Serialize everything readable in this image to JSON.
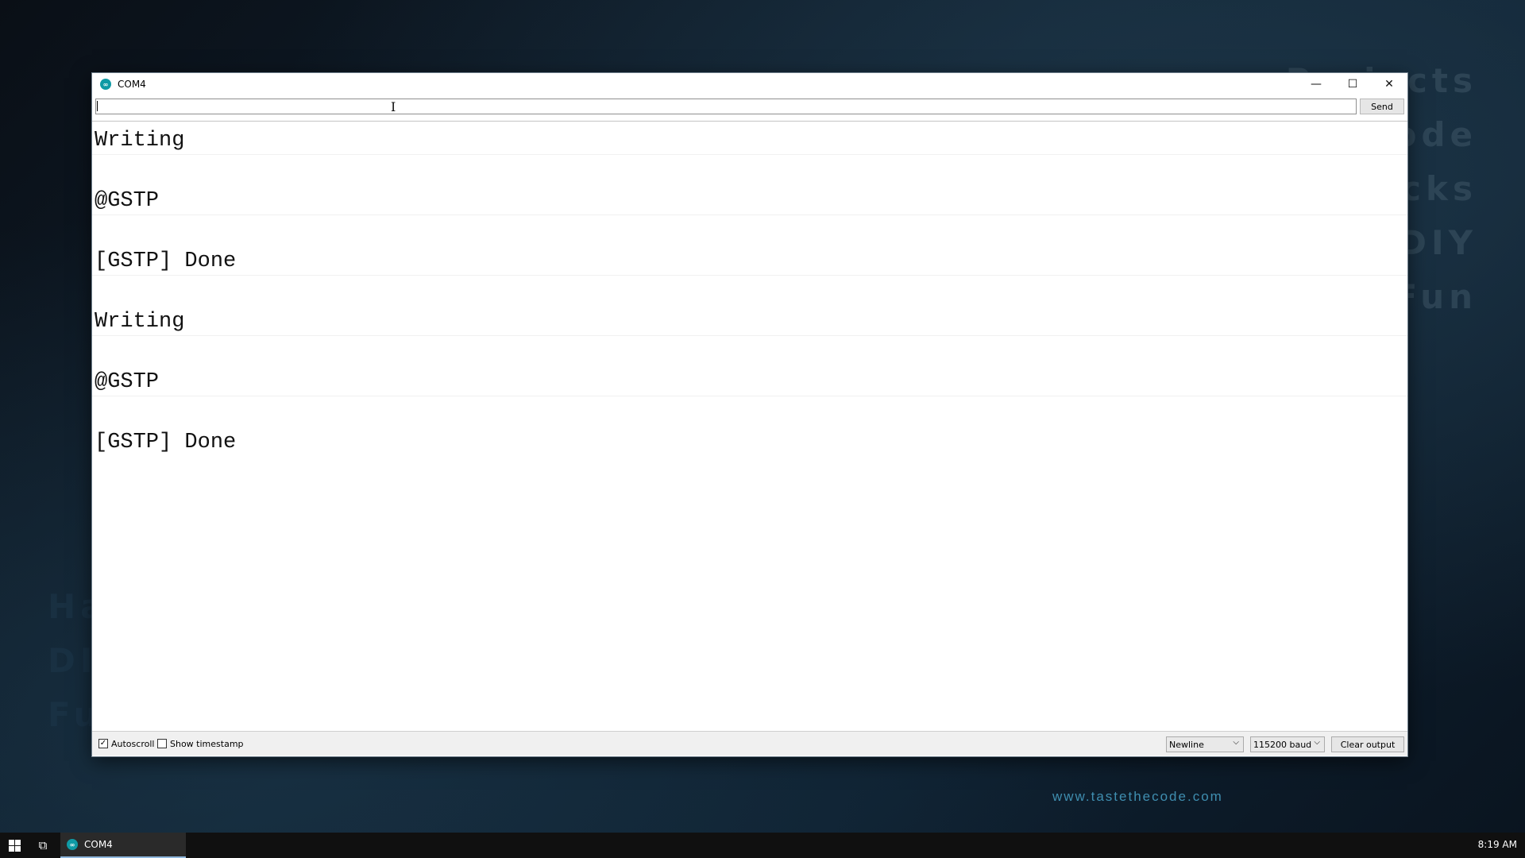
{
  "window": {
    "title": "COM4",
    "minimize_glyph": "—",
    "maximize_glyph": "☐",
    "close_glyph": "✕"
  },
  "send_row": {
    "input_value": "",
    "send_label": "Send"
  },
  "output": {
    "lines": [
      "Writing",
      "@GSTP",
      "[GSTP] Done",
      "Writing",
      "@GSTP",
      "[GSTP] Done"
    ]
  },
  "statusbar": {
    "autoscroll_label": "Autoscroll",
    "autoscroll_checked": true,
    "timestamp_label": "Show timestamp",
    "timestamp_checked": false,
    "line_ending": "Newline",
    "baud_rate": "115200 baud",
    "clear_label": "Clear output"
  },
  "desktop": {
    "right_words": [
      "Projects",
      "Code",
      "Hacks",
      "DIY",
      "Fun"
    ],
    "left_words": [
      "Hacks",
      "DIY",
      "Fun"
    ],
    "url": "www.tastethecode.com"
  },
  "taskbar": {
    "app_label": "COM4",
    "clock": "8:19 AM"
  },
  "colors": {
    "app_icon": "#0f9aa5",
    "url_text": "#3f8eb0"
  }
}
